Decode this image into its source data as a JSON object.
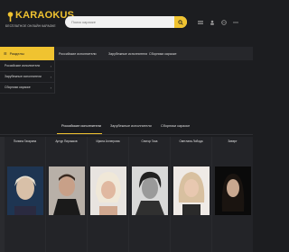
{
  "header": {
    "logo_title": "KARAOKUS",
    "logo_subtitle": "БЕСПЛАТНОЕ ОНЛАЙН КАРАОКЕ",
    "search_placeholder": "Поиск караоке",
    "icons": [
      "microphone-icon",
      "search-icon",
      "menu-icon",
      "user-icon",
      "globe-icon",
      "more-icon"
    ]
  },
  "nav": {
    "home_label": "Разделы",
    "links": [
      "Российские исполнители",
      "Зарубежные исполнители",
      "Сборники караоке"
    ]
  },
  "sidebar": {
    "items": [
      {
        "label": "Российские исполнители"
      },
      {
        "label": "Зарубежные исполнители"
      },
      {
        "label": "Сборники караоке"
      }
    ]
  },
  "tabs": [
    "Российские исполнители",
    "Зарубежные исполнители",
    "Сборники караоке"
  ],
  "active_tab": 0,
  "artists": [
    {
      "name": "Полина Гагарина"
    },
    {
      "name": "Артур Пирожков"
    },
    {
      "name": "Ирина Аллегрова"
    },
    {
      "name": "Сектор Газа"
    },
    {
      "name": "Светлана Лобода"
    },
    {
      "name": "Зиверт"
    }
  ],
  "colors": {
    "accent": "#f0c330",
    "background": "#1c1d20",
    "panel": "#26272b"
  }
}
